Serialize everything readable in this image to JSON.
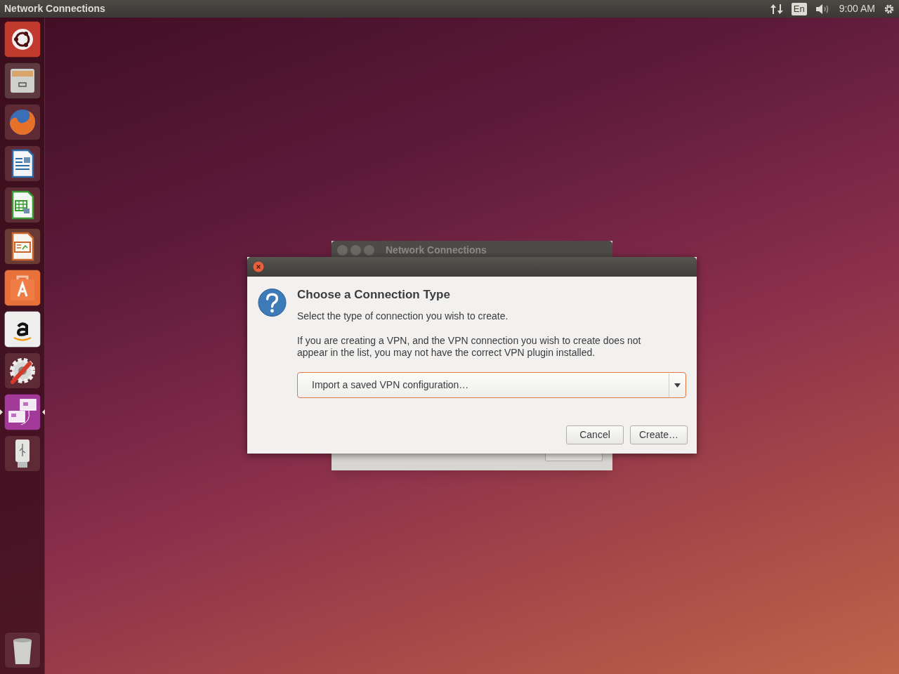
{
  "top_bar": {
    "title": "Network Connections",
    "keyboard": "En",
    "clock": "9:00 AM"
  },
  "launcher": {
    "items": [
      {
        "kind": "ubuntu",
        "active": false
      },
      {
        "kind": "files",
        "active": false
      },
      {
        "kind": "firefox",
        "active": false
      },
      {
        "kind": "writer",
        "active": false
      },
      {
        "kind": "calc",
        "active": false
      },
      {
        "kind": "impress",
        "active": false
      },
      {
        "kind": "software",
        "active": false
      },
      {
        "kind": "amazon",
        "active": false
      },
      {
        "kind": "settings",
        "active": false
      },
      {
        "kind": "network",
        "active": true
      },
      {
        "kind": "usb",
        "active": false
      }
    ],
    "bottom_items": [
      {
        "kind": "trash",
        "active": false
      }
    ]
  },
  "background_window": {
    "title": "Network Connections"
  },
  "dialog": {
    "heading": "Choose a Connection Type",
    "message": "Select the type of connection you wish to create.",
    "detail": "If you are creating a VPN, and the VPN connection you wish to create does not appear in the list, you may not have the correct VPN plugin installed.",
    "combo": {
      "value": "Import a saved VPN configuration…"
    },
    "buttons": [
      "Cancel",
      "Create…"
    ]
  }
}
